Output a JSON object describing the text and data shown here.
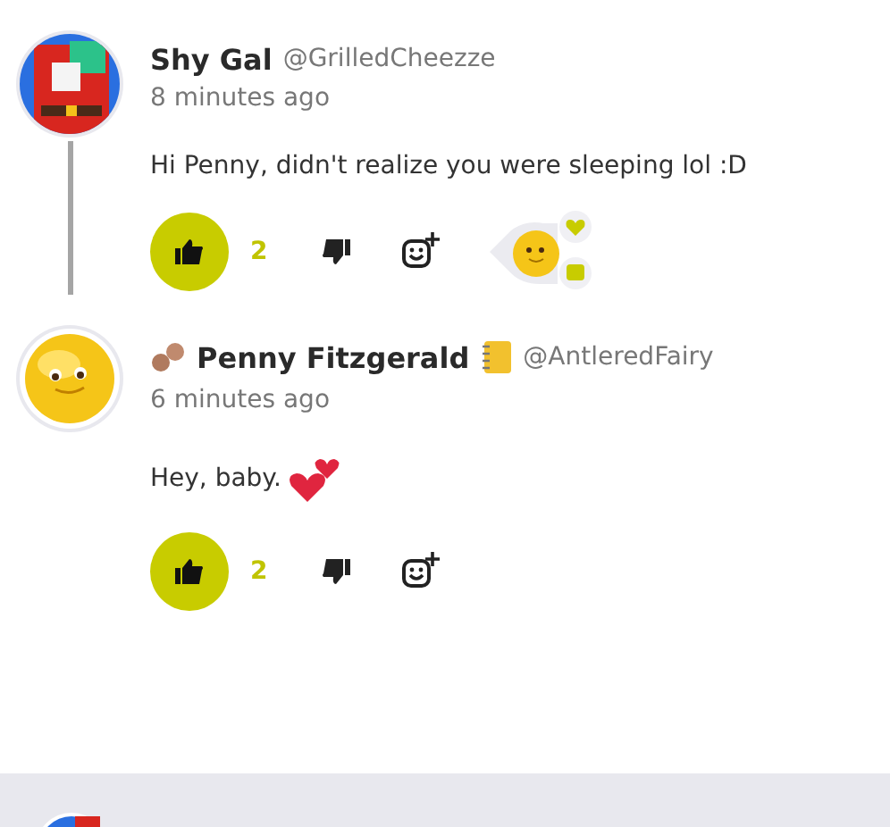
{
  "comments": [
    {
      "author": "Shy Gal",
      "handle": "@GrilledCheezze",
      "time": "8 minutes ago",
      "text": "Hi Penny, didn't realize you were sleeping lol :D",
      "text_hearts": false,
      "flair": false,
      "likes": "2",
      "liked": true,
      "reaction_bubble": true,
      "thread_line": true
    },
    {
      "author": "Penny Fitzgerald",
      "handle": "@AntleredFairy",
      "time": "6 minutes ago",
      "text": "Hey, baby.",
      "text_hearts": true,
      "flair": true,
      "likes": "2",
      "liked": true,
      "reaction_bubble": false,
      "thread_line": false
    }
  ]
}
